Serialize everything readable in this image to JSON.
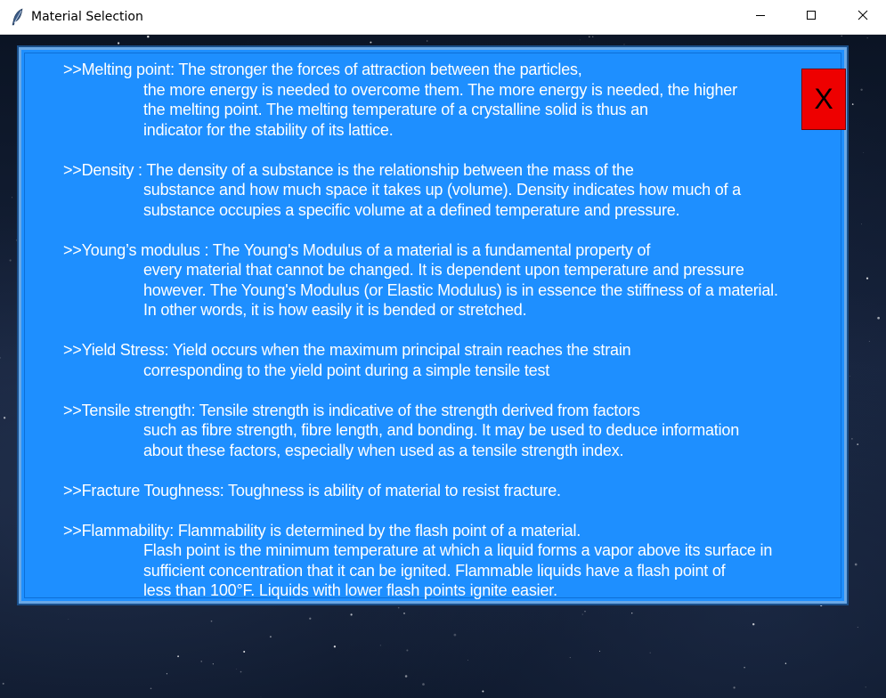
{
  "window": {
    "title": "Material Selection",
    "controls": {
      "minimize": "minimize-icon",
      "maximize": "maximize-icon",
      "close": "close-icon"
    }
  },
  "colors": {
    "panel_bg": "#1e8fff",
    "panel_border": "#6aa8e6",
    "text": "#ffffff",
    "close_button": "#ee0000"
  },
  "close_button": {
    "label": "X"
  },
  "entries": [
    {
      "heading": ">>Melting point: The stronger the forces of attraction between the particles,",
      "lines": [
        "the more energy is needed to overcome them. The more energy is needed, the higher",
        "the melting point. The melting temperature of a crystalline solid is thus an",
        "indicator for the stability of its lattice."
      ]
    },
    {
      "heading": ">>Density : The density of a substance is the relationship between the mass of the",
      "lines": [
        "substance and how much space it takes up (volume). Density indicates how much of a",
        "substance occupies a specific volume at a defined temperature and pressure."
      ]
    },
    {
      "heading": ">>Young’s modulus : The Young's Modulus of a material is a fundamental property of",
      "lines": [
        "every material that cannot be changed. It is dependent upon temperature and pressure",
        "however. The Young's Modulus (or Elastic Modulus) is in essence the stiffness of a material.",
        "In other words, it is how easily it is bended or stretched."
      ]
    },
    {
      "heading": ">>Yield Stress: Yield occurs when the maximum principal strain reaches the strain",
      "lines": [
        "corresponding to the yield point during a simple tensile test"
      ]
    },
    {
      "heading": ">>Tensile strength: Tensile strength is indicative of the strength derived from factors",
      "lines": [
        "such as fibre strength, fibre length, and bonding. It may be used to deduce information",
        "about these factors, especially when used as a tensile strength index."
      ]
    },
    {
      "heading": ">>Fracture Toughness: Toughness is ability of material to resist fracture.",
      "lines": []
    },
    {
      "heading": ">>Flammability: Flammability is determined by the flash point of a material.",
      "lines": [
        "Flash point is the minimum temperature at which a liquid forms a vapor above its surface in",
        "sufficient concentration that it can be ignited. Flammable liquids have a flash point of",
        "less than 100°F. Liquids with lower flash points ignite easier."
      ]
    }
  ]
}
